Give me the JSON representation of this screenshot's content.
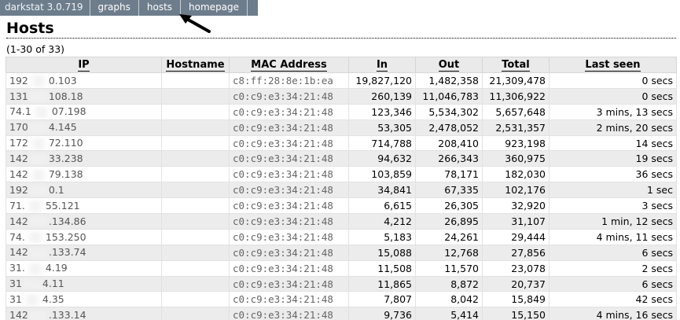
{
  "menu": {
    "brand": "darkstat 3.0.719",
    "items": [
      "graphs",
      "hosts",
      "homepage"
    ]
  },
  "page": {
    "title": "Hosts",
    "range": "(1-30 of 33)"
  },
  "table": {
    "columns": [
      "IP",
      "Hostname",
      "MAC Address",
      "In",
      "Out",
      "Total",
      "Last seen"
    ],
    "rows": [
      {
        "ip_a": "192",
        "ip_b": "0.103",
        "hostname": "",
        "mac": "c8:ff:28:8e:1b:ea",
        "in": "19,827,120",
        "out": "1,482,358",
        "total": "21,309,478",
        "last_seen": "0 secs"
      },
      {
        "ip_a": "131",
        "ip_b": "108.18",
        "hostname": "",
        "mac": "c0:c9:e3:34:21:48",
        "in": "260,139",
        "out": "11,046,783",
        "total": "11,306,922",
        "last_seen": "0 secs"
      },
      {
        "ip_a": "74.1",
        "ip_b": "07.198",
        "hostname": "",
        "mac": "c0:c9:e3:34:21:48",
        "in": "123,346",
        "out": "5,534,302",
        "total": "5,657,648",
        "last_seen": "3 mins, 13 secs"
      },
      {
        "ip_a": "170",
        "ip_b": "4.145",
        "hostname": "",
        "mac": "c0:c9:e3:34:21:48",
        "in": "53,305",
        "out": "2,478,052",
        "total": "2,531,357",
        "last_seen": "2 mins, 20 secs"
      },
      {
        "ip_a": "172",
        "ip_b": "72.110",
        "hostname": "",
        "mac": "c0:c9:e3:34:21:48",
        "in": "714,788",
        "out": "208,410",
        "total": "923,198",
        "last_seen": "14 secs"
      },
      {
        "ip_a": "142",
        "ip_b": "33.238",
        "hostname": "",
        "mac": "c0:c9:e3:34:21:48",
        "in": "94,632",
        "out": "266,343",
        "total": "360,975",
        "last_seen": "19 secs"
      },
      {
        "ip_a": "142",
        "ip_b": "79.138",
        "hostname": "",
        "mac": "c0:c9:e3:34:21:48",
        "in": "103,859",
        "out": "78,171",
        "total": "182,030",
        "last_seen": "36 secs"
      },
      {
        "ip_a": "192",
        "ip_b": "0.1",
        "hostname": "",
        "mac": "c0:c9:e3:34:21:48",
        "in": "34,841",
        "out": "67,335",
        "total": "102,176",
        "last_seen": "1 sec"
      },
      {
        "ip_a": "71.",
        "ip_b": "55.121",
        "hostname": "",
        "mac": "c0:c9:e3:34:21:48",
        "in": "6,615",
        "out": "26,305",
        "total": "32,920",
        "last_seen": "3 secs"
      },
      {
        "ip_a": "142",
        "ip_b": ".134.86",
        "hostname": "",
        "mac": "c0:c9:e3:34:21:48",
        "in": "4,212",
        "out": "26,895",
        "total": "31,107",
        "last_seen": "1 min, 12 secs"
      },
      {
        "ip_a": "74.",
        "ip_b": "153.250",
        "hostname": "",
        "mac": "c0:c9:e3:34:21:48",
        "in": "5,183",
        "out": "24,261",
        "total": "29,444",
        "last_seen": "4 mins, 11 secs"
      },
      {
        "ip_a": "142",
        "ip_b": ".133.74",
        "hostname": "",
        "mac": "c0:c9:e3:34:21:48",
        "in": "15,088",
        "out": "12,768",
        "total": "27,856",
        "last_seen": "6 secs"
      },
      {
        "ip_a": "31.",
        "ip_b": "4.19",
        "hostname": "",
        "mac": "c0:c9:e3:34:21:48",
        "in": "11,508",
        "out": "11,570",
        "total": "23,078",
        "last_seen": "2 secs"
      },
      {
        "ip_a": "31",
        "ip_b": "4.11",
        "hostname": "",
        "mac": "c0:c9:e3:34:21:48",
        "in": "11,865",
        "out": "8,872",
        "total": "20,737",
        "last_seen": "6 secs"
      },
      {
        "ip_a": "31",
        "ip_b": "4.35",
        "hostname": "",
        "mac": "c0:c9:e3:34:21:48",
        "in": "7,807",
        "out": "8,042",
        "total": "15,849",
        "last_seen": "42 secs"
      },
      {
        "ip_a": "142",
        "ip_b": ".133.14",
        "hostname": "",
        "mac": "c0:c9:e3:34:21:48",
        "in": "9,736",
        "out": "5,414",
        "total": "15,150",
        "last_seen": "4 mins, 16 secs"
      }
    ]
  },
  "colors": {
    "menu_bg": "#6e7d8c",
    "header_bg": "#eaeaea",
    "row_alt": "#ececec"
  }
}
